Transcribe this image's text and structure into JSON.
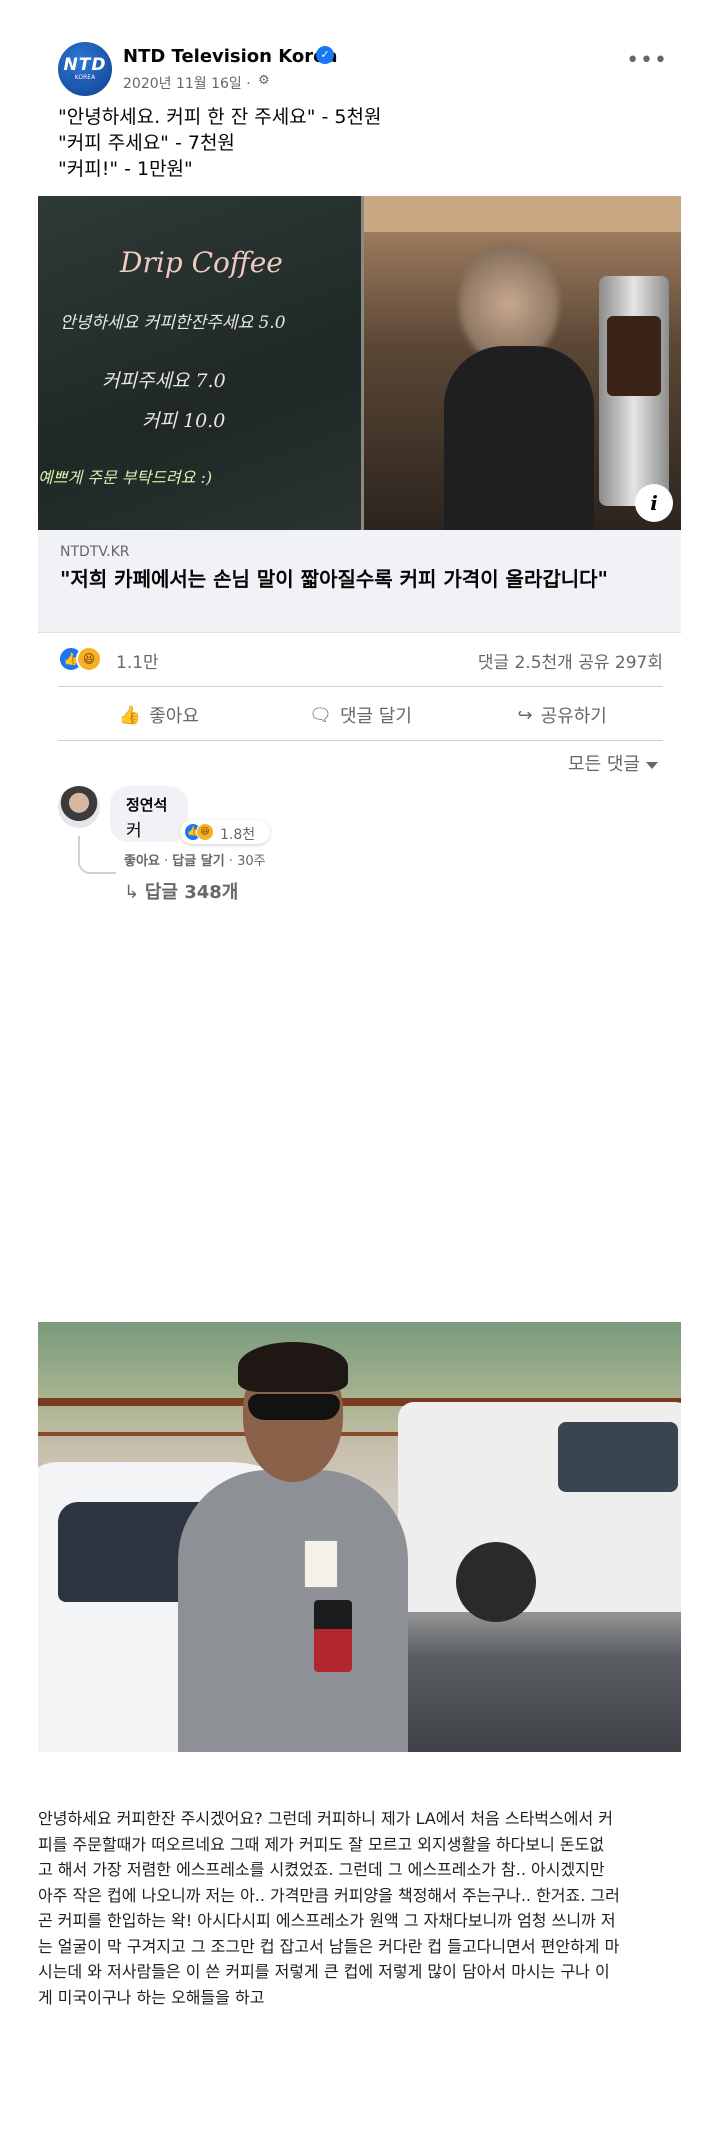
{
  "post": {
    "page_name": "NTD Television Korea",
    "avatar_text": "NTD",
    "avatar_subtext": "KOREA",
    "date": "2020년 11월 16일 ·",
    "privacy_icon": "gear-icon",
    "more_icon": "more-dots-icon",
    "text_lines": [
      "\"안녕하세요. 커피 한 잔 주세요\" - 5천원",
      "\"커피 주세요\" - 7천원",
      "\"커피!\" - 1만원\""
    ]
  },
  "media": {
    "chalkboard_lines": [
      "Drip Coffee",
      "안녕하세요 커피한잔주세요 5.0",
      "커피주세요 7.0",
      "커피 10.0",
      "예쁘게 주문 부탁드려요 :)"
    ],
    "info_label": "i"
  },
  "link": {
    "domain": "NTDTV.KR",
    "title": "\"저희 카페에서는 손님 말이 짧아질수록 커피 가격이 올라갑니다\""
  },
  "stats": {
    "reaction_count": "1.1만",
    "comments_shares": "댓글 2.5천개  공유 297회"
  },
  "actions": {
    "like": "좋아요",
    "comment": "댓글 달기",
    "share": "공유하기"
  },
  "comments_filter": "모든 댓글",
  "comment": {
    "author": "정연석",
    "text": "커",
    "reaction_count": "1.8천",
    "meta_like": "좋아요",
    "meta_reply": "답글 달기",
    "meta_time": "30주",
    "replies": "답글 348개"
  },
  "story_lines": [
    "안녕하세요 커피한잔 주시겠어요? 그런데 커피하니 제가 LA에서 처음 스타벅스에서 커",
    "피를 주문할때가 떠오르네요 그때 제가 커피도 잘 모르고 외지생활을 하다보니 돈도없",
    "고 해서 가장 저렴한 에스프레소를 시켰었죠. 그런데 그 에스프레소가 참.. 아시겠지만",
    "아주 작은 컵에 나오니까 저는 아.. 가격만큼 커피양을 책정해서 주는구나.. 한거죠. 그러",
    "곤 커피를 한입하는 왁! 아시다시피 에스프레소가 원액 그 자채다보니까 엄청 쓰니까 저",
    "는 얼굴이 막 구겨지고 그 조그만 컵 잡고서 남들은 커다란 컵 들고다니면서 편안하게 마",
    "시는데 와 저사람들은 이 쓴 커피를 저렇게 큰 컵에 저렇게 많이 담아서 마시는 구나 이",
    "게 미국이구나 하는 오해들을 하고"
  ],
  "colors": {
    "accent": "#1877f2",
    "secondary_text": "#65676b",
    "link_box_bg": "#f0f2f5"
  }
}
